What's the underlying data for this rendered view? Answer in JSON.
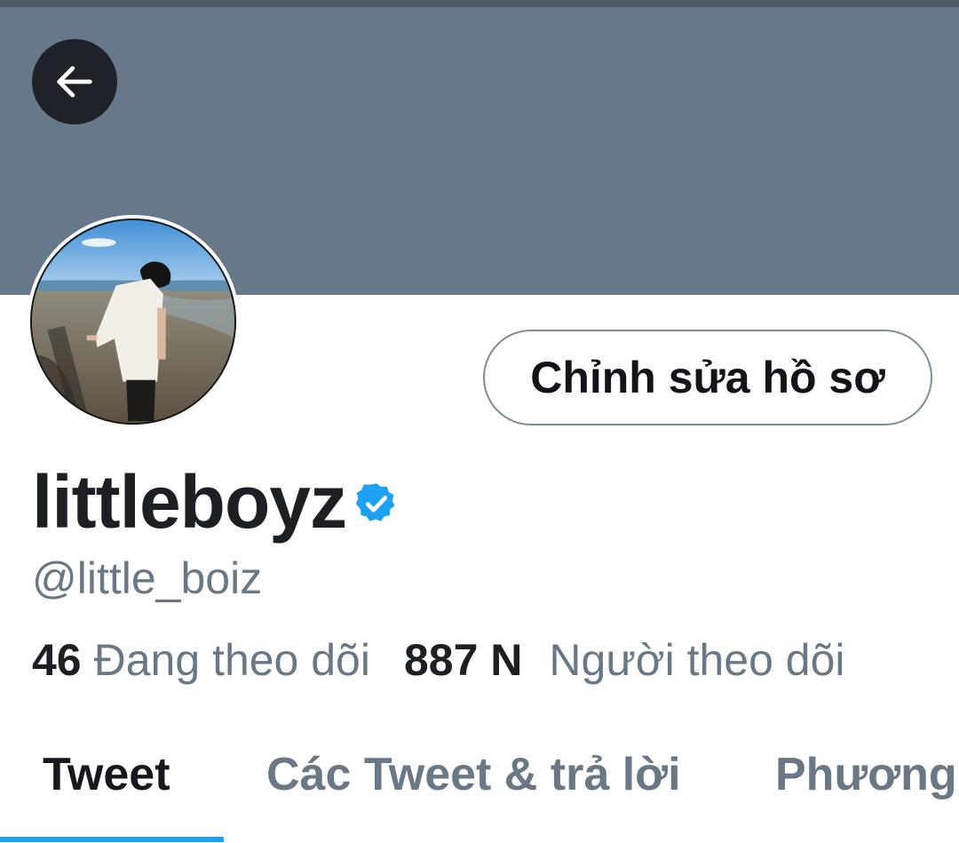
{
  "header": {
    "back_icon": "arrow-left-icon",
    "banner_color": "#66788a"
  },
  "profile": {
    "avatar_icon": "profile-photo",
    "edit_button_label": "Chỉnh sửa hồ sơ",
    "display_name": "littleboyz",
    "verified_icon": "verified-badge-icon",
    "handle": "@little_boiz"
  },
  "stats": {
    "following_count": "46",
    "following_label": "Đang theo dõi",
    "followers_count": "887 N",
    "followers_label": "Người theo dõi"
  },
  "tabs": [
    {
      "label": "Tweet",
      "active": true
    },
    {
      "label": "Các Tweet & trả lời",
      "active": false
    },
    {
      "label": "Phương",
      "active": false
    }
  ],
  "colors": {
    "accent": "#1da1f2",
    "text_primary": "#1c1f23",
    "text_secondary": "#6a7886"
  }
}
